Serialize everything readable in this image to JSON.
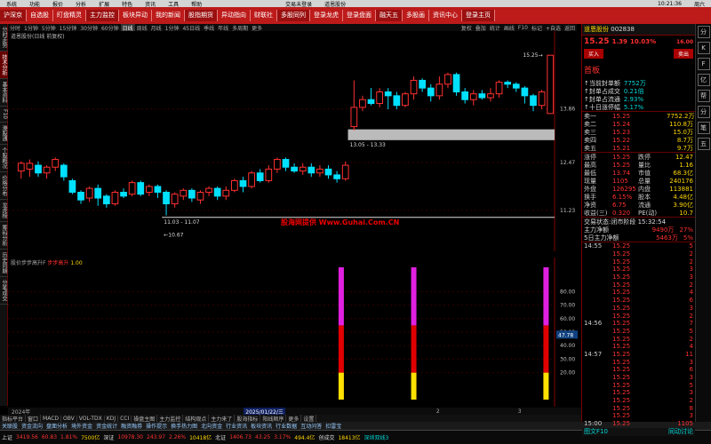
{
  "menubar": {
    "items": [
      "系统",
      "功能",
      "报价",
      "分析",
      "扩展",
      "特色",
      "资讯",
      "工具",
      "帮助"
    ],
    "title": "交易未登录",
    "stock_title": "道恩股份",
    "time": "10:21:36",
    "weekday": "周六"
  },
  "toolbar": {
    "buttons": [
      "沪深京",
      "自选股",
      "盯盘精灵",
      "主力监控",
      "板块异动",
      "我的新闻",
      "股指期货",
      "异动指向",
      "财联社",
      "多股同列",
      "登录龙虎",
      "登录盘面",
      "融天五",
      "多股画",
      "资讯中心",
      "登录主页"
    ]
  },
  "left_tabs": [
    "分时走势",
    "技术分析",
    "基本资料",
    "F10",
    "港股通",
    "个股概况",
    "价格分布",
    "龙虎榜",
    "筹码分析",
    "历史同期",
    "分笔成交"
  ],
  "periodbar": {
    "items": [
      "分时",
      "1分钟",
      "5分钟",
      "15分钟",
      "30分钟",
      "60分钟",
      "日线",
      "周线",
      "月线",
      "1分钟",
      "45日线",
      "季线",
      "年线",
      "多周期",
      "更多"
    ],
    "selected": "日线",
    "right_items": [
      "复权",
      "叠加",
      "统计",
      "画线",
      "F10",
      "标记",
      "+自选",
      "返回"
    ]
  },
  "chart_title": "道恩股份(日线 前复权)",
  "scales": {
    "main": [
      "13.86",
      "12.47",
      "11.23"
    ],
    "ind": [
      "80.00",
      "70.00",
      "60.00",
      "50.00",
      "40.00",
      "30.00",
      "20.00"
    ],
    "ind_tag": "47.78"
  },
  "annotations": {
    "range_label": "13.05 - 13.33",
    "low_label": "11.03 - 11.07",
    "low_price": "10.67",
    "high_price": "15.25"
  },
  "indicator": {
    "name": "股价步步高升F",
    "param": "步步高升",
    "value": "1.00"
  },
  "watermark": "股海网提供 Www.Guhai.Com.CN",
  "datebar": {
    "left": "2024年",
    "tag": "2025/01/22/三",
    "marks": [
      "2",
      "3"
    ]
  },
  "ctrlbar": [
    "指标平台",
    "窗口",
    "MACD",
    "OBV",
    "VOL-TDX",
    "KDJ",
    "CCI",
    "操盘主图",
    "主力监控",
    "结构观点",
    "主力来了",
    "股海指标",
    "阳线顺序",
    "更多",
    "设置"
  ],
  "tabsbar": [
    "关联股",
    "资金流向",
    "盘面分析",
    "境外资金",
    "资金统计",
    "融资融券",
    "操作提示",
    "换手热力图",
    "北向资金",
    "行业资讯",
    "板块资讯",
    "行业数据",
    "互动问答",
    "扣雷宝"
  ],
  "status": {
    "sh_label": "上证",
    "sh_val": "3419.56",
    "sh_chg": "60.83",
    "sh_pct": "1.81%",
    "sh_amt": "7500亿",
    "sz_label": "深证",
    "sz_val": "10978.30",
    "sz_chg": "243.97",
    "sz_pct": "2.26%",
    "sz_amt": "10418亿",
    "bz_label": "北证",
    "bz_val": "1406.73",
    "bz_chg": "43.25",
    "bz_pct": "3.17%",
    "bz_amt": "494.4亿",
    "cyb_label": "创成交",
    "cyb_val": "18413亿",
    "info": "深圳双线3"
  },
  "quote": {
    "code": "002838",
    "name": "道恩股份",
    "price": "15.25",
    "change": "1.39",
    "pct": "10.03%",
    "sub": "16.00",
    "buy": "买入",
    "sell": "卖出",
    "tag": "首板",
    "notes": [
      {
        "l": "当前封单额",
        "v": "7752万"
      },
      {
        "l": "封单占成交",
        "v": "0.21倍"
      },
      {
        "l": "封单占流通",
        "v": "2.93%"
      },
      {
        "l": "十日涨停幅",
        "v": "5.17%"
      }
    ],
    "asks": [
      {
        "l": "卖一",
        "p": "15.25",
        "v": "7752.2万"
      },
      {
        "l": "卖二",
        "p": "15.24",
        "v": "110.8万"
      },
      {
        "l": "卖三",
        "p": "15.23",
        "v": "15.0万"
      },
      {
        "l": "卖四",
        "p": "15.22",
        "v": "8.7万"
      },
      {
        "l": "卖五",
        "p": "15.21",
        "v": "9.7万"
      }
    ],
    "stats": [
      {
        "l": "涨停",
        "p": "15.25",
        "l2": "跌停",
        "v": "12.47"
      },
      {
        "l": "最高",
        "p": "15.25",
        "l2": "量比",
        "v": "1.16"
      },
      {
        "l": "最低",
        "p": "13.74",
        "l2": "市值",
        "v": "68.3亿"
      },
      {
        "l": "现量",
        "p": "1105",
        "l2": "总量",
        "v": "240176"
      },
      {
        "l": "外盘",
        "p": "126295",
        "l2": "内盘",
        "v": "113881"
      },
      {
        "l": "换手",
        "p": "6.15%",
        "l2": "股本",
        "v": "4.48亿"
      },
      {
        "l": "净资",
        "p": "6.75",
        "l2": "流通",
        "v": "3.90亿"
      },
      {
        "l": "收益(三)",
        "p": "0.320",
        "l2": "PE(动)",
        "v": "10.7"
      }
    ],
    "trade_status": "交易状态:闭市阶段 15:32:54",
    "flows": [
      {
        "l": "主力净额",
        "v": "9490万",
        "r": "27%"
      },
      {
        "l": "5日主力净额",
        "v": "5463万",
        "r": "5%"
      }
    ],
    "ticks": [
      {
        "t": "14:55",
        "p": "15.25",
        "v": "5"
      },
      {
        "t": "",
        "p": "15.25",
        "v": "2"
      },
      {
        "t": "",
        "p": "15.25",
        "v": "2"
      },
      {
        "t": "",
        "p": "15.25",
        "v": "3"
      },
      {
        "t": "",
        "p": "15.25",
        "v": "3"
      },
      {
        "t": "",
        "p": "15.25",
        "v": "2"
      },
      {
        "t": "",
        "p": "15.25",
        "v": "4"
      },
      {
        "t": "",
        "p": "15.25",
        "v": "6"
      },
      {
        "t": "",
        "p": "15.25",
        "v": "3"
      },
      {
        "t": "",
        "p": "15.25",
        "v": "2"
      },
      {
        "t": "14:56",
        "p": "15.25",
        "v": "7"
      },
      {
        "t": "",
        "p": "15.25",
        "v": "5"
      },
      {
        "t": "",
        "p": "15.25",
        "v": "2"
      },
      {
        "t": "",
        "p": "15.25",
        "v": "4"
      },
      {
        "t": "14:57",
        "p": "15.25",
        "v": "11"
      },
      {
        "t": "",
        "p": "15.25",
        "v": "3"
      },
      {
        "t": "",
        "p": "15.25",
        "v": "6"
      },
      {
        "t": "",
        "p": "15.25",
        "v": "3"
      },
      {
        "t": "",
        "p": "15.25",
        "v": "5"
      },
      {
        "t": "",
        "p": "15.25",
        "v": "3"
      },
      {
        "t": "",
        "p": "15.25",
        "v": "2"
      },
      {
        "t": "",
        "p": "15.25",
        "v": "8"
      },
      {
        "t": "",
        "p": "15.25",
        "v": "3"
      },
      {
        "t": "15:00",
        "p": "15.25",
        "v": "1105"
      }
    ],
    "bottom": {
      "l": "图文F10",
      "v": "同动讨论"
    }
  },
  "mini_buttons": [
    "分",
    "K",
    "F",
    "亿",
    "帮",
    "分",
    "笔",
    "五"
  ],
  "colors": {
    "up": "#ff3030",
    "down": "#00e0ff",
    "magenta": "#e020e0",
    "red": "#e00000",
    "yellow": "#ffe000",
    "brand": "#bd1a1a"
  },
  "chart_data": {
    "type": "candlestick",
    "ylim": [
      10.4,
      15.6
    ],
    "ticks": [
      13.86,
      12.47,
      11.23
    ],
    "candles": [
      [
        12.25,
        12.45,
        12.05,
        12.5
      ],
      [
        12.3,
        12.45,
        12.1,
        12.55
      ],
      [
        12.4,
        12.2,
        12.1,
        12.5
      ],
      [
        12.2,
        12.35,
        12.05,
        12.4
      ],
      [
        12.35,
        12.55,
        12.25,
        12.6
      ],
      [
        12.4,
        12.1,
        12.0,
        12.45
      ],
      [
        12.0,
        11.7,
        11.65,
        12.05
      ],
      [
        11.7,
        11.5,
        11.4,
        11.75
      ],
      [
        11.55,
        11.8,
        11.45,
        11.85
      ],
      [
        11.8,
        11.55,
        11.35,
        11.9
      ],
      [
        11.6,
        11.4,
        11.3,
        11.65
      ],
      [
        11.4,
        11.7,
        11.35,
        11.75
      ],
      [
        11.7,
        11.6,
        11.55,
        11.8
      ],
      [
        11.65,
        11.95,
        11.6,
        12.0
      ],
      [
        11.95,
        11.65,
        11.6,
        12.0
      ],
      [
        11.7,
        11.85,
        11.6,
        11.9
      ],
      [
        11.85,
        11.7,
        11.55,
        11.9
      ],
      [
        11.7,
        11.4,
        11.1,
        11.75
      ],
      [
        11.4,
        11.65,
        11.3,
        11.7
      ],
      [
        11.6,
        11.75,
        11.5,
        11.8
      ],
      [
        11.75,
        11.55,
        11.45,
        11.8
      ],
      [
        11.5,
        11.7,
        11.4,
        11.75
      ],
      [
        11.7,
        11.8,
        11.6,
        11.85
      ],
      [
        11.8,
        11.6,
        11.5,
        11.85
      ],
      [
        11.6,
        11.75,
        11.5,
        11.85
      ],
      [
        11.75,
        12.0,
        11.7,
        12.05
      ],
      [
        12.0,
        11.85,
        11.7,
        12.1
      ],
      [
        11.85,
        12.2,
        11.8,
        12.25
      ],
      [
        12.2,
        12.0,
        11.95,
        12.3
      ],
      [
        12.0,
        12.3,
        11.95,
        12.4
      ],
      [
        12.3,
        12.55,
        12.2,
        12.6
      ],
      [
        12.55,
        12.35,
        12.25,
        12.6
      ],
      [
        12.35,
        12.25,
        12.2,
        12.45
      ],
      [
        12.25,
        12.35,
        12.15,
        12.45
      ],
      [
        12.35,
        12.2,
        12.1,
        12.45
      ],
      [
        12.2,
        12.3,
        12.1,
        12.4
      ],
      [
        12.3,
        12.15,
        12.05,
        12.4
      ],
      [
        12.15,
        12.05,
        11.95,
        12.25
      ],
      [
        12.05,
        12.4,
        12.0,
        12.5
      ],
      [
        13.4,
        13.9,
        13.3,
        14.6
      ],
      [
        13.9,
        14.1,
        13.8,
        14.2
      ],
      [
        14.1,
        14.0,
        13.95,
        14.4
      ],
      [
        14.0,
        14.3,
        13.9,
        14.4
      ],
      [
        14.3,
        14.2,
        13.85,
        14.4
      ],
      [
        14.2,
        13.95,
        13.85,
        14.3
      ],
      [
        13.95,
        14.25,
        13.9,
        14.3
      ],
      [
        14.25,
        14.6,
        14.1,
        14.7
      ],
      [
        14.6,
        14.4,
        14.3,
        14.65
      ],
      [
        14.4,
        14.2,
        14.05,
        14.5
      ],
      [
        14.2,
        14.5,
        14.1,
        14.7
      ],
      [
        14.5,
        14.75,
        14.4,
        14.8
      ],
      [
        14.75,
        14.3,
        14.2,
        14.8
      ],
      [
        14.3,
        14.1,
        14.0,
        14.4
      ],
      [
        14.1,
        14.25,
        13.95,
        14.35
      ],
      [
        14.25,
        14.15,
        14.1,
        14.35
      ],
      [
        14.15,
        14.25,
        14.05,
        14.4
      ],
      [
        14.25,
        14.55,
        14.15,
        14.6
      ],
      [
        14.55,
        14.5,
        14.4,
        14.6
      ],
      [
        14.5,
        14.4,
        14.3,
        14.55
      ],
      [
        14.4,
        14.2,
        14.0,
        14.45
      ],
      [
        14.2,
        13.95,
        13.8,
        14.25
      ],
      [
        13.95,
        14.3,
        13.85,
        14.35
      ],
      [
        13.74,
        15.25,
        13.74,
        15.25
      ]
    ],
    "indicator": {
      "bars_at": [
        39,
        62
      ],
      "levels": [
        0.2,
        0.55,
        0.9
      ],
      "ylim": [
        0,
        100
      ]
    }
  }
}
